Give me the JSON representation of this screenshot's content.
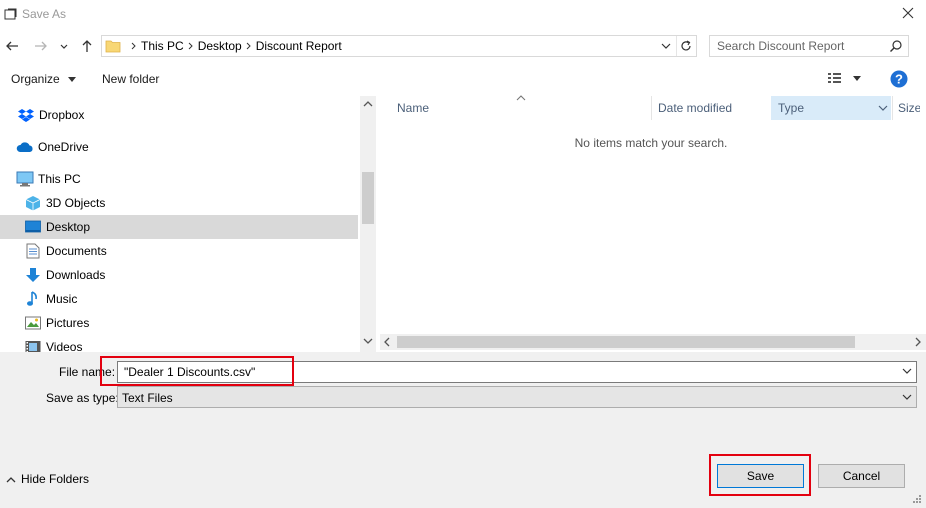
{
  "window": {
    "title": "Save As"
  },
  "address": {
    "crumbs": [
      "This PC",
      "Desktop",
      "Discount Report"
    ]
  },
  "search": {
    "placeholder": "Search Discount Report"
  },
  "toolbar": {
    "organize_label": "Organize",
    "new_folder_label": "New folder"
  },
  "nav": {
    "items": [
      {
        "label": "Dropbox",
        "icon": "dropbox-icon"
      },
      {
        "label": "OneDrive",
        "icon": "onedrive-cloud-icon"
      },
      {
        "label": "This PC",
        "icon": "computer-icon"
      },
      {
        "label": "3D Objects",
        "icon": "cube-icon"
      },
      {
        "label": "Desktop",
        "icon": "desktop-icon",
        "selected": true
      },
      {
        "label": "Documents",
        "icon": "document-icon"
      },
      {
        "label": "Downloads",
        "icon": "download-arrow-icon"
      },
      {
        "label": "Music",
        "icon": "music-note-icon"
      },
      {
        "label": "Pictures",
        "icon": "pictures-icon"
      },
      {
        "label": "Videos",
        "icon": "film-icon"
      }
    ]
  },
  "columns": {
    "name": "Name",
    "date_modified": "Date modified",
    "type": "Type",
    "size": "Size"
  },
  "content": {
    "empty_message": "No items match your search."
  },
  "form": {
    "file_name_label": "File name:",
    "file_name_value": "\"Dealer 1 Discounts.csv\"",
    "save_as_type_label": "Save as type:",
    "save_as_type_value": "Text Files"
  },
  "footer": {
    "hide_folders_label": "Hide Folders",
    "save_label": "Save",
    "cancel_label": "Cancel"
  },
  "colors": {
    "highlight_box": "#e3000f",
    "selected_nav": "#d9d9d9",
    "type_column": "#d9ebf9",
    "accent": "#0078d7"
  }
}
